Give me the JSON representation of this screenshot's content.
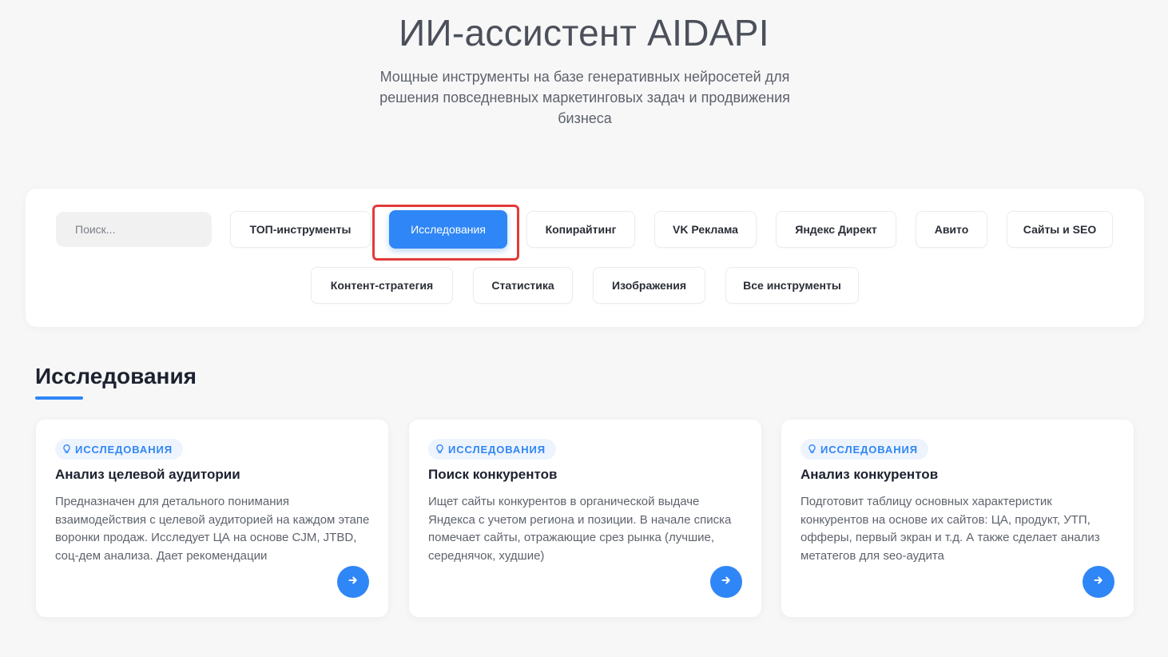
{
  "hero": {
    "title": "ИИ-ассистент AIDAPI",
    "subtitle": "Мощные инструменты на базе генеративных нейросетей для решения повседневных маркетинговых задач и продвижения бизнеса"
  },
  "filters": {
    "search_placeholder": "Поиск...",
    "chips": [
      "ТОП-инструменты",
      "Исследования",
      "Копирайтинг",
      "VK Реклама",
      "Яндекс Директ",
      "Авито",
      "Сайты и SEO",
      "Контент-стратегия",
      "Статистика",
      "Изображения",
      "Все инструменты"
    ],
    "active": "Исследования"
  },
  "section": {
    "title": "Исследования"
  },
  "cards": [
    {
      "badge": "ИССЛЕДОВАНИЯ",
      "title": "Анализ целевой аудитории",
      "description": "Предназначен для детального понимания взаимодействия с целевой аудиторией на каждом этапе воронки продаж. Исследует ЦА на основе CJM, JTBD, соц-дем анализа. Дает рекомендации"
    },
    {
      "badge": "ИССЛЕДОВАНИЯ",
      "title": "Поиск конкурентов",
      "description": "Ищет сайты конкурентов в органической выдаче Яндекса с учетом региона и позиции. В начале списка помечает сайты, отражающие срез рынка (лучшие, середнячок, худшие)"
    },
    {
      "badge": "ИССЛЕДОВАНИЯ",
      "title": "Анализ конкурентов",
      "description": "Подготовит таблицу основных характеристик конкурентов на основе их сайтов: ЦА, продукт, УТП, офферы, первый экран и т.д. А также сделает анализ метатегов для seo-аудита"
    }
  ],
  "colors": {
    "accent": "#2f86f6",
    "highlight": "#e23a3a",
    "background": "#f7f7f8"
  }
}
